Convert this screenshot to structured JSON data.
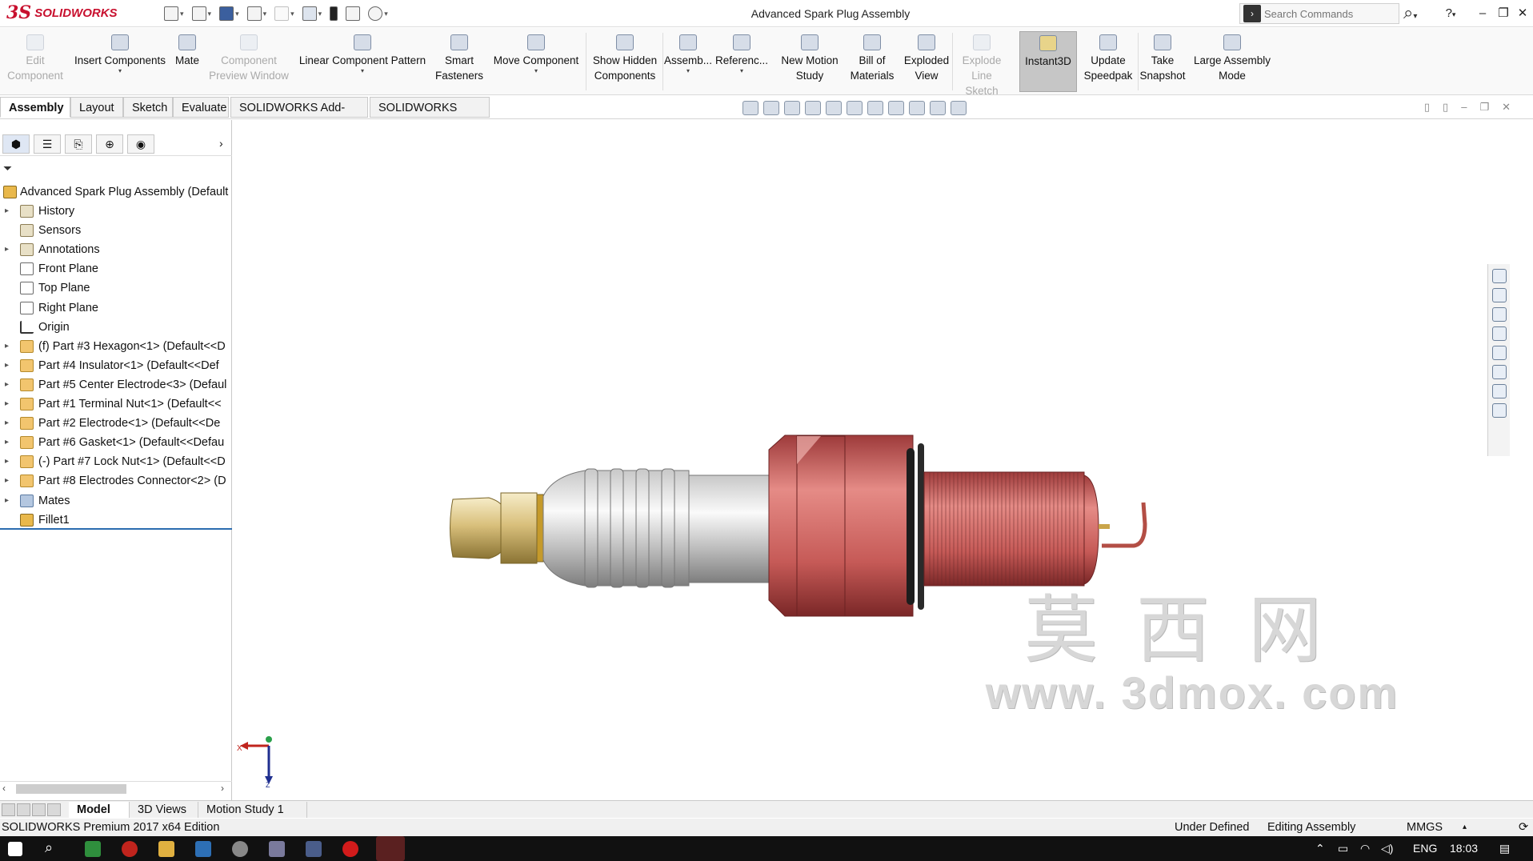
{
  "app": {
    "brand": "SOLIDWORKS",
    "title": "Advanced Spark Plug Assembly",
    "accent": "#c8102e"
  },
  "search": {
    "placeholder": "Search Commands"
  },
  "ribbon": [
    {
      "label": "Edit\nComponent",
      "disabled": true,
      "icon": "edit-component-icon"
    },
    {
      "label": "Insert Components",
      "disabled": false,
      "icon": "insert-components-icon"
    },
    {
      "label": "Mate",
      "disabled": false,
      "icon": "mate-icon"
    },
    {
      "label": "Component\nPreview Window",
      "disabled": true,
      "icon": "component-preview-icon"
    },
    {
      "label": "Linear Component Pattern",
      "disabled": false,
      "icon": "linear-pattern-icon"
    },
    {
      "label": "Smart\nFasteners",
      "disabled": false,
      "icon": "smart-fasteners-icon"
    },
    {
      "label": "Move Component",
      "disabled": false,
      "icon": "move-component-icon"
    },
    {
      "label": "Show Hidden\nComponents",
      "disabled": false,
      "icon": "show-hidden-icon"
    },
    {
      "label": "Assemb...",
      "disabled": false,
      "icon": "assembly-features-icon"
    },
    {
      "label": "Referenc...",
      "disabled": false,
      "icon": "reference-geometry-icon"
    },
    {
      "label": "New Motion\nStudy",
      "disabled": false,
      "icon": "motion-study-icon"
    },
    {
      "label": "Bill of\nMaterials",
      "disabled": false,
      "icon": "bom-icon"
    },
    {
      "label": "Exploded\nView",
      "disabled": false,
      "icon": "exploded-view-icon"
    },
    {
      "label": "Explode\nLine Sketch",
      "disabled": true,
      "icon": "explode-line-icon"
    },
    {
      "label": "Instant3D",
      "disabled": false,
      "active": true,
      "icon": "instant3d-icon"
    },
    {
      "label": "Update\nSpeedpak",
      "disabled": false,
      "icon": "speedpak-icon"
    },
    {
      "label": "Take\nSnapshot",
      "disabled": false,
      "icon": "snapshot-icon"
    },
    {
      "label": "Large Assembly\nMode",
      "disabled": false,
      "icon": "large-assembly-icon"
    }
  ],
  "command_tabs": [
    "Assembly",
    "Layout",
    "Sketch",
    "Evaluate",
    "SOLIDWORKS Add-Ins",
    "SOLIDWORKS MBD"
  ],
  "tree": {
    "root": "Advanced Spark Plug Assembly  (Default",
    "items": [
      {
        "label": "History",
        "type": "folder",
        "expand": true
      },
      {
        "label": "Sensors",
        "type": "folder",
        "expand": false
      },
      {
        "label": "Annotations",
        "type": "folder",
        "expand": true
      },
      {
        "label": "Front Plane",
        "type": "plane",
        "expand": false
      },
      {
        "label": "Top Plane",
        "type": "plane",
        "expand": false
      },
      {
        "label": "Right Plane",
        "type": "plane",
        "expand": false
      },
      {
        "label": "Origin",
        "type": "origin",
        "expand": false
      },
      {
        "label": "(f) Part #3 Hexagon<1> (Default<<D",
        "type": "part",
        "expand": true
      },
      {
        "label": "Part #4 Insulator<1> (Default<<Def",
        "type": "part",
        "expand": true
      },
      {
        "label": "Part #5 Center Electrode<3> (Defaul",
        "type": "part",
        "expand": true
      },
      {
        "label": "Part #1 Terminal Nut<1> (Default<<",
        "type": "part",
        "expand": true
      },
      {
        "label": "Part #2 Electrode<1> (Default<<De",
        "type": "part",
        "expand": true
      },
      {
        "label": "Part #6 Gasket<1> (Default<<Defau",
        "type": "part",
        "expand": true
      },
      {
        "label": "(-) Part #7 Lock Nut<1> (Default<<D",
        "type": "part",
        "expand": true
      },
      {
        "label": "Part #8 Electrodes Connector<2> (D",
        "type": "part",
        "expand": true
      },
      {
        "label": "Mates",
        "type": "mates",
        "expand": true
      },
      {
        "label": "Fillet1",
        "type": "feature",
        "expand": false
      }
    ]
  },
  "bottom_tabs": [
    "Model",
    "3D Views",
    "Motion Study 1"
  ],
  "status": {
    "edition": "SOLIDWORKS Premium 2017 x64 Edition",
    "defined": "Under Defined",
    "mode": "Editing Assembly",
    "units": "MMGS"
  },
  "watermark": {
    "chars": "莫西网",
    "url": "www. 3dmox. com"
  },
  "taskbar": {
    "lang": "ENG",
    "time": "18:03"
  }
}
